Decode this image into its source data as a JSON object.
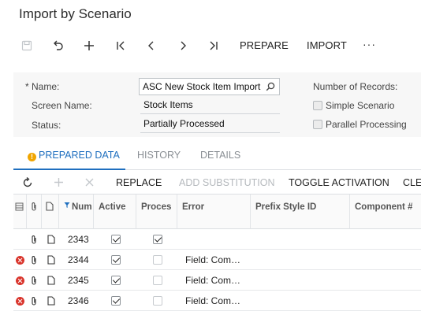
{
  "page": {
    "title": "Import by Scenario"
  },
  "toolbar": {
    "prepare_label": "PREPARE",
    "import_label": "IMPORT",
    "more_label": "···",
    "icons": [
      "save-icon",
      "undo-icon",
      "add-icon",
      "first-record-icon",
      "previous-record-icon",
      "next-record-icon",
      "last-record-icon"
    ]
  },
  "summary": {
    "name_required": "*",
    "name_label": "Name:",
    "name_value": "ASC New Stock Item Import",
    "screen_name_label": "Screen Name:",
    "screen_name_value": "Stock Items",
    "status_label": "Status:",
    "status_value": "Partially Processed",
    "records_label": "Number of Records:",
    "simple_scenario_label": "Simple Scenario",
    "simple_scenario_checked": false,
    "parallel_processing_label": "Parallel Processing",
    "parallel_processing_checked": false
  },
  "tabs": [
    {
      "label": "PREPARED DATA",
      "active": true,
      "warning": "!"
    },
    {
      "label": "HISTORY",
      "active": false
    },
    {
      "label": "DETAILS",
      "active": false
    }
  ],
  "grid_toolbar": {
    "replace_label": "REPLACE",
    "add_substitution_label": "ADD SUBSTITUTION",
    "toggle_activation_label": "TOGGLE ACTIVATION",
    "clear_label": "CLE"
  },
  "grid": {
    "columns": {
      "num": "Num",
      "active": "Active",
      "processed": "Proces",
      "error": "Error",
      "prefix_style_id": "Prefix Style ID",
      "component": "Component #"
    },
    "rows": [
      {
        "num": "2343",
        "active": true,
        "processed": true,
        "error": "",
        "has_error": false
      },
      {
        "num": "2344",
        "active": true,
        "processed": false,
        "error": "Field: Com…",
        "has_error": true
      },
      {
        "num": "2345",
        "active": true,
        "processed": false,
        "error": "Field: Com…",
        "has_error": true
      },
      {
        "num": "2346",
        "active": true,
        "processed": false,
        "error": "Field: Com…",
        "has_error": true
      }
    ]
  },
  "colors": {
    "accent": "#1f6fbf",
    "error": "#d9342b",
    "warning": "#f0a500"
  }
}
